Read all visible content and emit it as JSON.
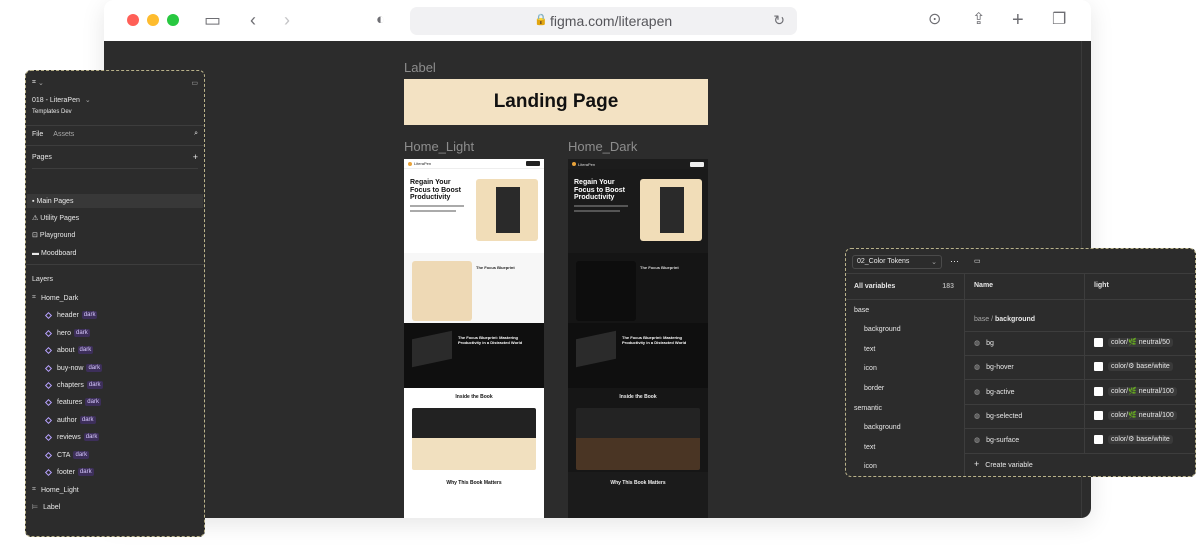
{
  "browser": {
    "url": "figma.com/literapen",
    "icons": {
      "sidebar": "sidebar-icon",
      "back": "chevron-left-icon",
      "forward": "chevron-right-icon",
      "shield": "shield-icon",
      "lock": "lock-icon",
      "reload": "reload-icon",
      "download": "download-icon",
      "share": "share-icon",
      "new_tab": "plus-icon",
      "tabs": "tabs-icon"
    }
  },
  "canvas": {
    "label_frame": "Label",
    "banner_text": "Landing Page",
    "frame_light": "Home_Light",
    "frame_dark": "Home_Dark",
    "thumb": {
      "brand": "LiteraPen",
      "hero_title": "Regain Your Focus to Boost Productivity",
      "sec2_title": "The Focus Blueprint",
      "sec3_title": "The Focus Blueprint: Mastering Productivity in a Distracted World",
      "sec4_title": "Inside the Book",
      "sec5_title": "Why This Book Matters"
    }
  },
  "layers_panel": {
    "file_name": "018 - LiteraPen",
    "team": "Templates Dev",
    "tabs": [
      "File",
      "Assets"
    ],
    "pages_heading": "Pages",
    "pages": [
      "Main Pages",
      "Utility Pages",
      "Playground",
      "Moodboard"
    ],
    "layers_heading": "Layers",
    "home_dark": "Home_Dark",
    "children": [
      {
        "name": "header",
        "tag": "dark"
      },
      {
        "name": "hero",
        "tag": "dark"
      },
      {
        "name": "about",
        "tag": "dark"
      },
      {
        "name": "buy-now",
        "tag": "dark"
      },
      {
        "name": "chapters",
        "tag": "dark"
      },
      {
        "name": "features",
        "tag": "dark"
      },
      {
        "name": "author",
        "tag": "dark"
      },
      {
        "name": "reviews",
        "tag": "dark"
      },
      {
        "name": "CTA",
        "tag": "dark"
      },
      {
        "name": "footer",
        "tag": "dark"
      }
    ],
    "home_light": "Home_Light",
    "label": "Label"
  },
  "variables_panel": {
    "collection": "02_Color Tokens",
    "all_variables": "All variables",
    "count": "183",
    "col_name": "Name",
    "col_mode": "light",
    "groups": [
      {
        "label": "base",
        "level": 0
      },
      {
        "label": "background",
        "level": 1
      },
      {
        "label": "text",
        "level": 1
      },
      {
        "label": "icon",
        "level": 1
      },
      {
        "label": "border",
        "level": 1
      },
      {
        "label": "semantic",
        "level": 0
      },
      {
        "label": "background",
        "level": 1
      },
      {
        "label": "text",
        "level": 1
      },
      {
        "label": "icon",
        "level": 1
      }
    ],
    "path_prefix": "base / ",
    "path_current": "background",
    "rows": [
      {
        "name": "bg",
        "value": "color/🌿 neutral/50"
      },
      {
        "name": "bg-hover",
        "value": "color/⚙ base/white"
      },
      {
        "name": "bg-active",
        "value": "color/🌿 neutral/100"
      },
      {
        "name": "bg-selected",
        "value": "color/🌿 neutral/100"
      },
      {
        "name": "bg-surface",
        "value": "color/⚙ base/white"
      }
    ],
    "create_variable": "Create variable"
  }
}
